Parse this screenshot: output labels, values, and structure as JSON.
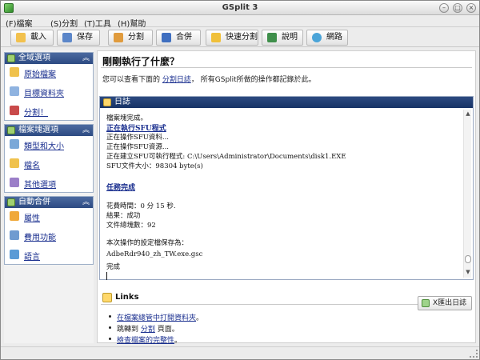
{
  "window": {
    "title": "GSplit 3"
  },
  "menu": [
    {
      "label": "(F)檔案"
    },
    {
      "label": "(S)分割"
    },
    {
      "label": "(T)工具"
    },
    {
      "label": "(H)幫助"
    }
  ],
  "toolbar": [
    {
      "label": "載入",
      "icon": "load-icon",
      "color": "#f2c14e"
    },
    {
      "label": "保存",
      "icon": "save-icon",
      "color": "#5b86c9"
    },
    {
      "label": "分割",
      "icon": "split-icon",
      "color": "#e09b3d"
    },
    {
      "label": "合併",
      "icon": "join-icon",
      "color": "#3f6fc0"
    },
    {
      "label": "快速分割",
      "icon": "quick-split-icon",
      "color": "#f0c03a"
    },
    {
      "label": "說明",
      "icon": "help-book-icon",
      "color": "#3f8f4b"
    },
    {
      "label": "網路",
      "icon": "globe-icon",
      "color": "#4aa4d8"
    }
  ],
  "sidebar": {
    "sections": [
      {
        "title": "全域選項",
        "items": [
          {
            "label": "原始檔案",
            "icon": "source-file-icon",
            "color": "#f0c24d"
          },
          {
            "label": "目標資料夾",
            "icon": "target-folder-icon",
            "color": "#8fb3e0"
          },
          {
            "label": "分割！",
            "icon": "scissors-icon",
            "color": "#c94a4a"
          }
        ]
      },
      {
        "title": "檔案塊選項",
        "items": [
          {
            "label": "類型和大小",
            "icon": "type-size-icon",
            "color": "#7aa8d8"
          },
          {
            "label": "檔名",
            "icon": "filename-icon",
            "color": "#f0c24d"
          },
          {
            "label": "其他選項",
            "icon": "other-options-icon",
            "color": "#9b7ec8"
          }
        ]
      },
      {
        "title": "自動合併",
        "items": [
          {
            "label": "屬性",
            "icon": "properties-icon",
            "color": "#f0a93a"
          },
          {
            "label": "費用功能",
            "icon": "cost-function-icon",
            "color": "#6f9bd0"
          },
          {
            "label": "語言",
            "icon": "language-icon",
            "color": "#5a9bd6"
          }
        ]
      }
    ]
  },
  "main": {
    "heading": "剛剛執行了什麼？",
    "desc_prefix": "您可以查看下面的 ",
    "desc_link": "分割日誌",
    "desc_suffix": "， 所有GSplit所做的操作都記錄於此。",
    "log": {
      "title": "日誌",
      "lines": [
        {
          "text": "檔案塊完成。",
          "bold": false
        },
        {
          "text": "正在執行SFU程式",
          "bold": true
        },
        {
          "text": "正在操作SFU資料...",
          "bold": false
        },
        {
          "text": "正在操作SFU資源...",
          "bold": false
        },
        {
          "text": "正在建立SFU可執行程式: C:\\Users\\Administrator\\Documents\\disk1.EXE",
          "bold": false
        },
        {
          "text": "SFU文件大小：98304 byte(s)",
          "bold": false
        },
        {
          "text": "",
          "bold": false
        },
        {
          "text": "任務完成",
          "bold": true
        },
        {
          "text": "",
          "bold": false
        },
        {
          "text": "花費時間：0 分 15 秒.",
          "bold": false
        },
        {
          "text": "結果：成功",
          "bold": false
        },
        {
          "text": "文件總塊數：92",
          "bold": false
        },
        {
          "text": "",
          "bold": false
        },
        {
          "text": "本次操作的設定檔保存為：",
          "bold": false
        },
        {
          "text": "AdbeRdr940_zh_TW.exe.gsc",
          "bold": false
        },
        {
          "text": "完成",
          "bold": false
        }
      ]
    },
    "links": {
      "title": "Links",
      "export_label": "X匯出日誌",
      "items": [
        {
          "prefix": "",
          "link": "在檔案總管中打開資料夾",
          "suffix": "。"
        },
        {
          "prefix": "跳轉到 ",
          "link": "分割",
          "suffix": " 頁面。"
        },
        {
          "prefix": "",
          "link": "檢查檔案的完整性",
          "suffix": "。"
        }
      ]
    }
  }
}
